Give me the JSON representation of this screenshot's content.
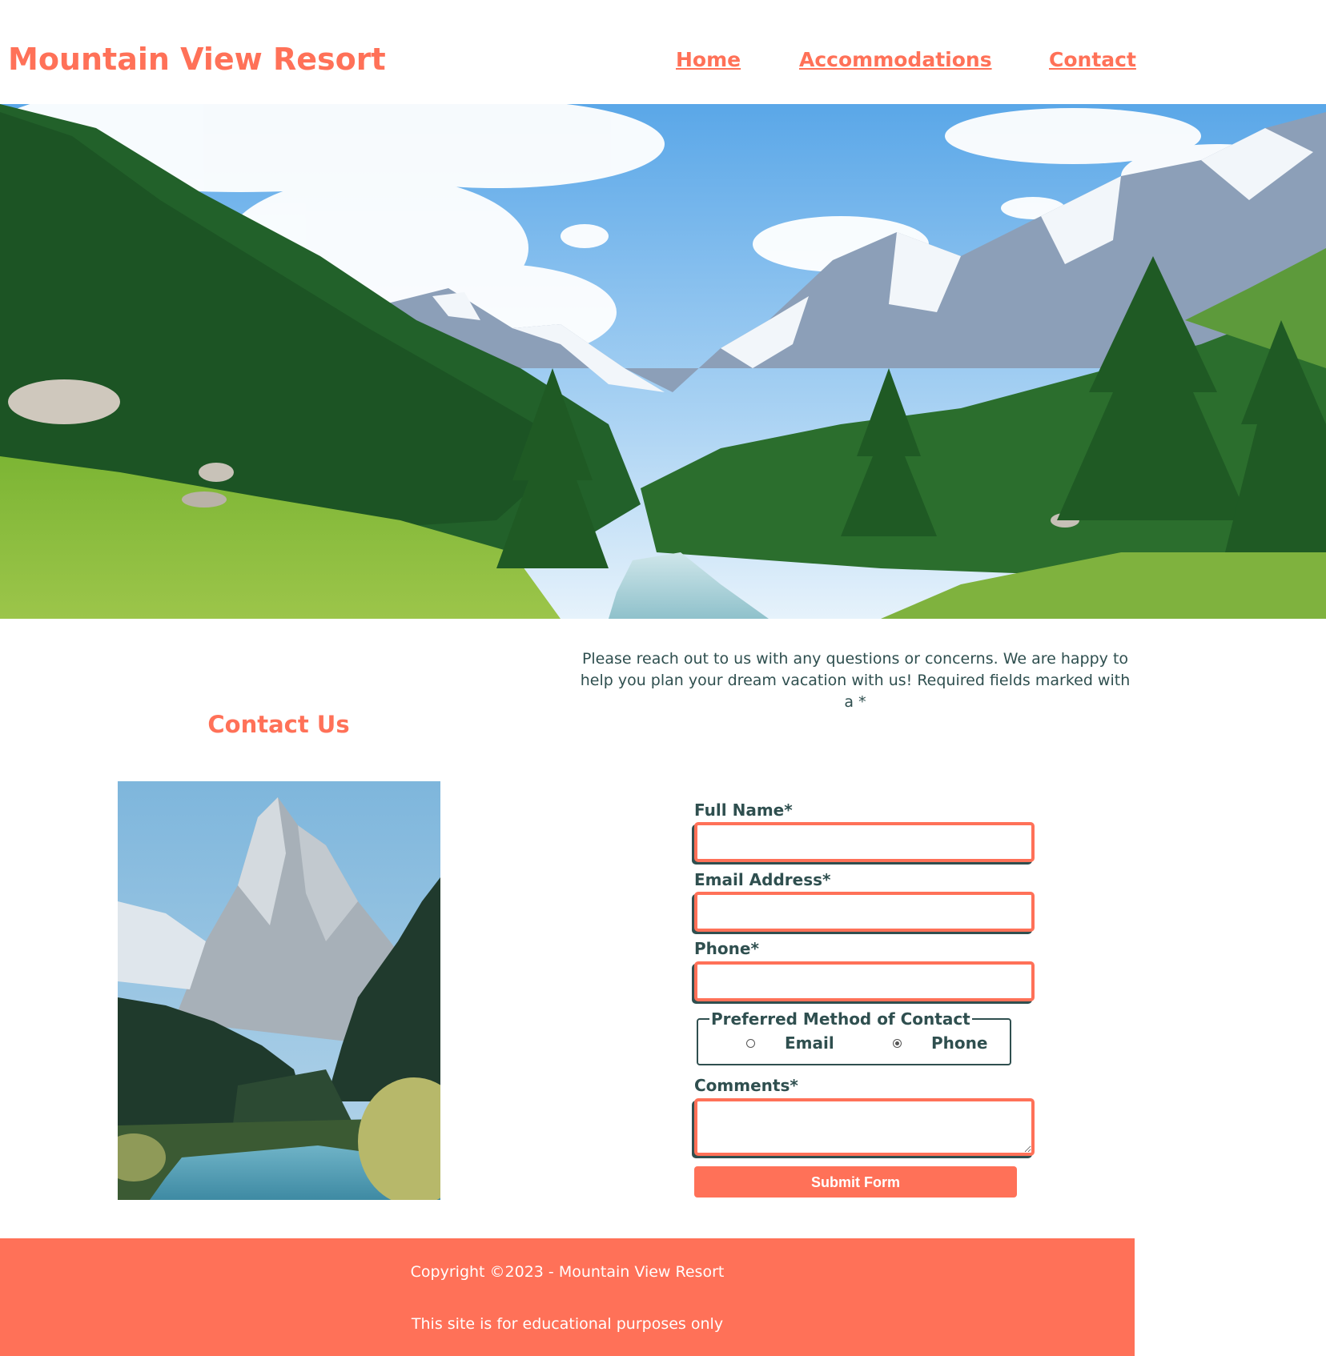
{
  "header": {
    "site_title": "Mountain View Resort",
    "nav": [
      {
        "label": "Home"
      },
      {
        "label": "Accommodations"
      },
      {
        "label": "Contact"
      }
    ]
  },
  "intro": {
    "text": "Please reach out to us with any questions or concerns. We are happy to help you plan your dream vacation with us! Required fields marked with a *"
  },
  "contact": {
    "heading": "Contact Us"
  },
  "form": {
    "full_name_label": "Full Name*",
    "email_label": "Email Address*",
    "phone_label": "Phone*",
    "full_name_value": "",
    "email_value": "",
    "phone_value": "",
    "contact_method": {
      "legend": "Preferred Method of Contact",
      "options": [
        {
          "label": "Email",
          "checked": false
        },
        {
          "label": "Phone",
          "checked": true
        }
      ]
    },
    "comments_label": "Comments*",
    "comments_value": "",
    "submit_label": "Submit Form"
  },
  "footer": {
    "copyright": "Copyright ©2023 - Mountain View Resort",
    "note": "This site is for educational purposes only"
  },
  "colors": {
    "accent": "#ff7158",
    "text": "#2f4f4f",
    "background": "#ffffff"
  }
}
